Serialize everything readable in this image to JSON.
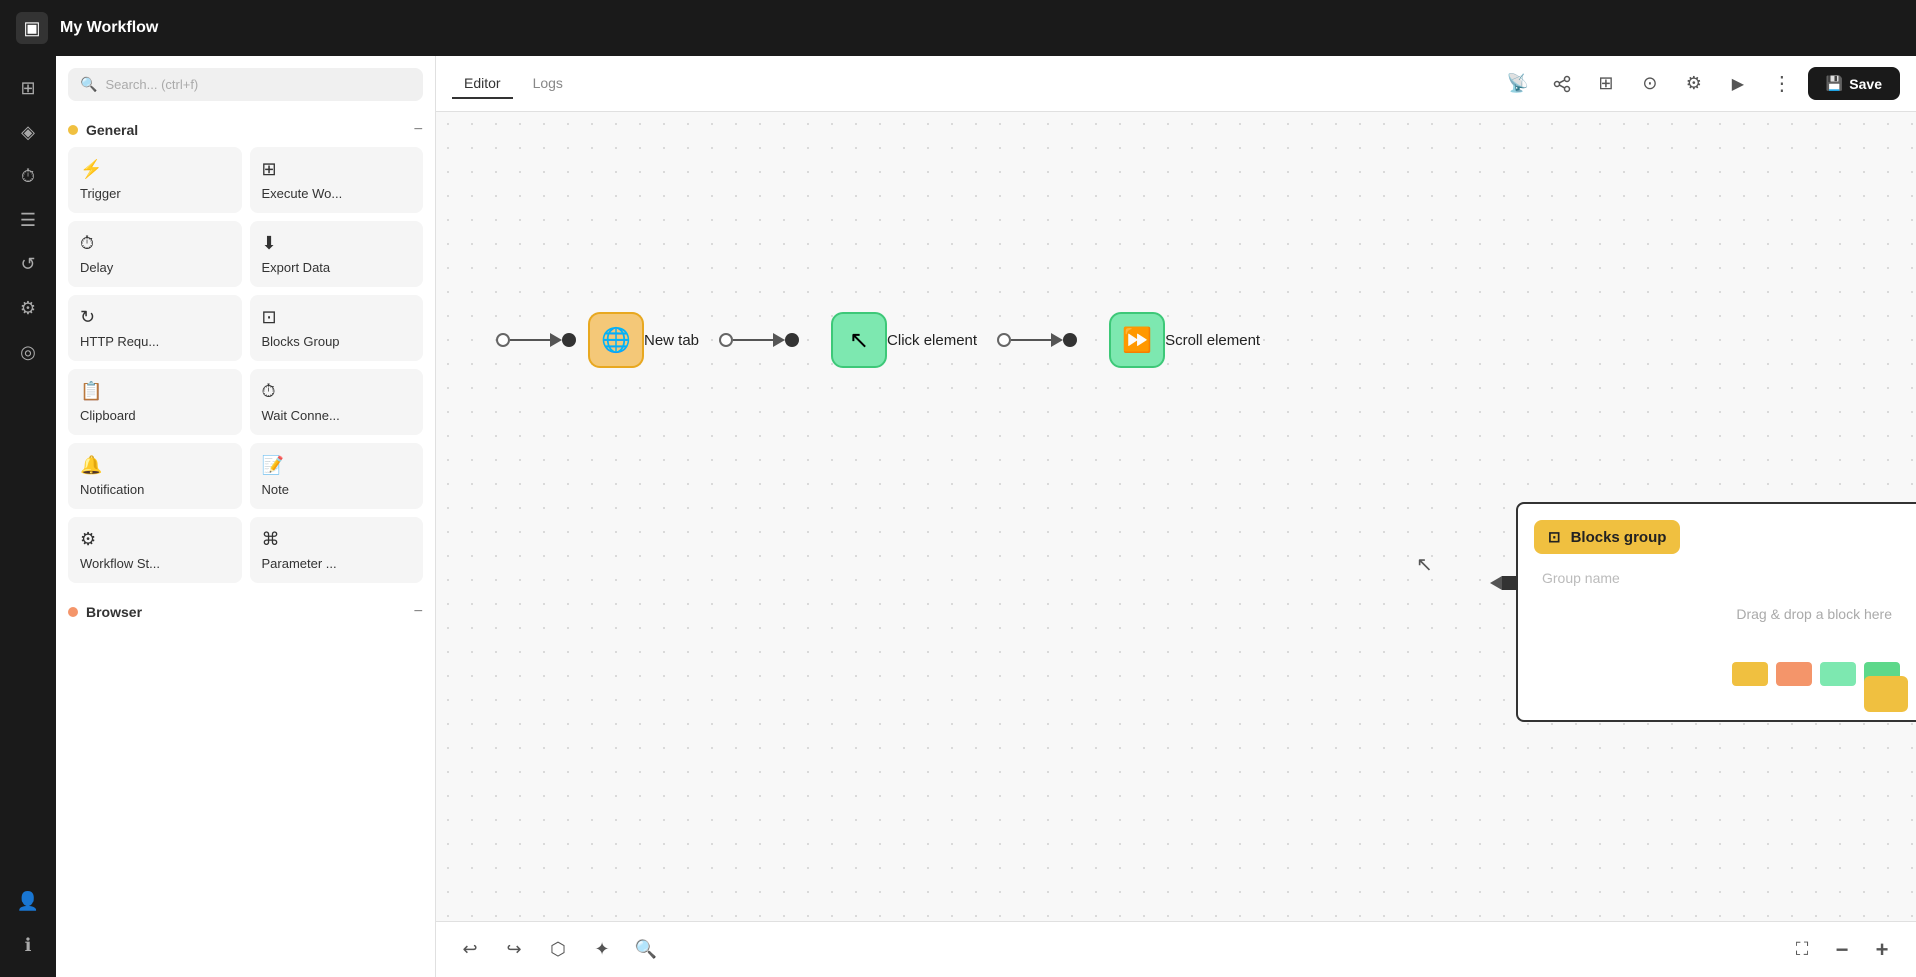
{
  "header": {
    "title": "My Workflow",
    "logo_icon": "▣"
  },
  "icon_sidebar": {
    "items": [
      {
        "name": "home-icon",
        "icon": "⊞",
        "label": "Home"
      },
      {
        "name": "shape-icon",
        "icon": "◈",
        "label": "Shape"
      },
      {
        "name": "clock-icon",
        "icon": "⏱",
        "label": "Clock"
      },
      {
        "name": "list-icon",
        "icon": "☰",
        "label": "List"
      },
      {
        "name": "history-icon",
        "icon": "↺",
        "label": "History"
      },
      {
        "name": "settings-icon",
        "icon": "⚙",
        "label": "Settings"
      },
      {
        "name": "location-icon",
        "icon": "◎",
        "label": "Location"
      }
    ],
    "bottom_items": [
      {
        "name": "user-icon",
        "icon": "👤",
        "label": "User"
      },
      {
        "name": "info-icon",
        "icon": "ℹ",
        "label": "Info"
      }
    ]
  },
  "left_panel": {
    "search_placeholder": "Search... (ctrl+f)",
    "sections": [
      {
        "id": "general",
        "label": "General",
        "dot_color": "#f0c040",
        "blocks": [
          {
            "id": "trigger",
            "icon": "⚡",
            "label": "Trigger"
          },
          {
            "id": "execute-workflow",
            "icon": "⊞",
            "label": "Execute Wo..."
          },
          {
            "id": "delay",
            "icon": "⏱",
            "label": "Delay"
          },
          {
            "id": "export-data",
            "icon": "⬇",
            "label": "Export Data"
          },
          {
            "id": "http-request",
            "icon": "↻",
            "label": "HTTP Requ..."
          },
          {
            "id": "blocks-group",
            "icon": "⊡",
            "label": "Blocks Group"
          },
          {
            "id": "clipboard",
            "icon": "📋",
            "label": "Clipboard"
          },
          {
            "id": "wait-connection",
            "icon": "⏱",
            "label": "Wait Conne..."
          },
          {
            "id": "notification",
            "icon": "🔔",
            "label": "Notification"
          },
          {
            "id": "note",
            "icon": "📝",
            "label": "Note"
          },
          {
            "id": "workflow-storage",
            "icon": "⚙",
            "label": "Workflow St..."
          },
          {
            "id": "parameter",
            "icon": "⌘",
            "label": "Parameter ..."
          }
        ]
      },
      {
        "id": "browser",
        "label": "Browser",
        "dot_color": "#f4956a"
      }
    ]
  },
  "toolbar": {
    "tabs": [
      {
        "id": "editor",
        "label": "Editor",
        "active": true
      },
      {
        "id": "logs",
        "label": "Logs",
        "active": false
      }
    ],
    "icons": [
      {
        "name": "broadcast-icon",
        "icon": "📡"
      },
      {
        "name": "share-icon",
        "icon": "⑂"
      },
      {
        "name": "grid-icon",
        "icon": "⊞"
      },
      {
        "name": "database-icon",
        "icon": "⊙"
      },
      {
        "name": "config-icon",
        "icon": "⚙"
      },
      {
        "name": "play-icon",
        "icon": "▶"
      },
      {
        "name": "more-icon",
        "icon": "⋮"
      }
    ],
    "save_label": "Save",
    "save_icon": "💾"
  },
  "canvas": {
    "nodes": [
      {
        "id": "new-tab",
        "label": "New tab",
        "icon": "🌐",
        "color": "#f4c878",
        "border_color": "#e8a820"
      },
      {
        "id": "click-element",
        "label": "Click element",
        "icon": "↖",
        "color": "#7de8b0",
        "border_color": "#3dc878"
      },
      {
        "id": "scroll-element",
        "label": "Scroll element",
        "icon": "⏩",
        "color": "#7de8b0",
        "border_color": "#3dc878"
      }
    ],
    "blocks_group_panel": {
      "title": "Blocks group",
      "icon": "⊡",
      "title_bg": "#f0c040",
      "group_name_label": "Group name",
      "drag_drop_hint": "Drag & drop a block here",
      "color_swatches": [
        "#f0c040",
        "#f4956a",
        "#7de8b0",
        "#5dd88a"
      ]
    }
  },
  "bottom_toolbar": {
    "icons": [
      {
        "name": "undo-icon",
        "icon": "↩"
      },
      {
        "name": "redo-icon",
        "icon": "↪"
      },
      {
        "name": "cube-icon",
        "icon": "⬡"
      },
      {
        "name": "star-icon",
        "icon": "✦"
      },
      {
        "name": "search-bottom-icon",
        "icon": "🔍"
      }
    ],
    "zoom_icons": [
      {
        "name": "fullscreen-icon",
        "icon": "⛶"
      },
      {
        "name": "zoom-out-icon",
        "icon": "−"
      },
      {
        "name": "zoom-in-icon",
        "icon": "+"
      }
    ]
  }
}
